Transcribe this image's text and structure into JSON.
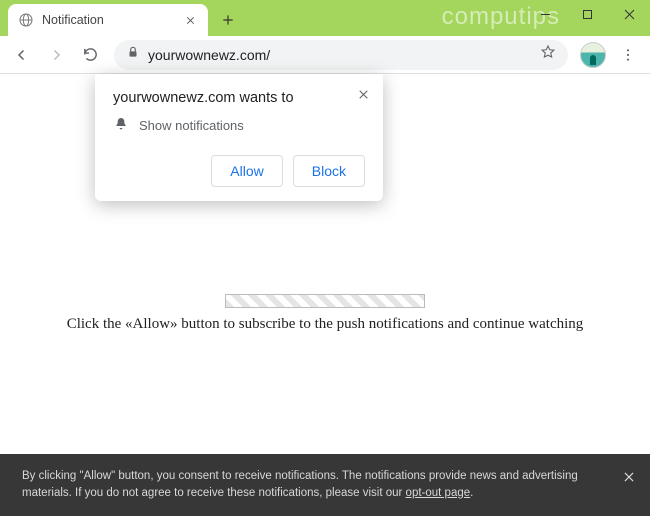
{
  "watermark": "computips",
  "tab": {
    "title": "Notification"
  },
  "toolbar": {
    "url": "yourwownewz.com/"
  },
  "permission": {
    "origin": "yourwownewz.com wants to",
    "capability": "Show notifications",
    "allow": "Allow",
    "block": "Block"
  },
  "page": {
    "instruction": "Click the «Allow» button to subscribe to the push notifications and continue watching"
  },
  "consent": {
    "text_prefix": "By clicking \"Allow\" button, you consent to receive notifications. The notifications provide news and advertising materials. If you do not agree to receive these notifications, please visit our ",
    "link": "opt-out page",
    "text_suffix": "."
  }
}
